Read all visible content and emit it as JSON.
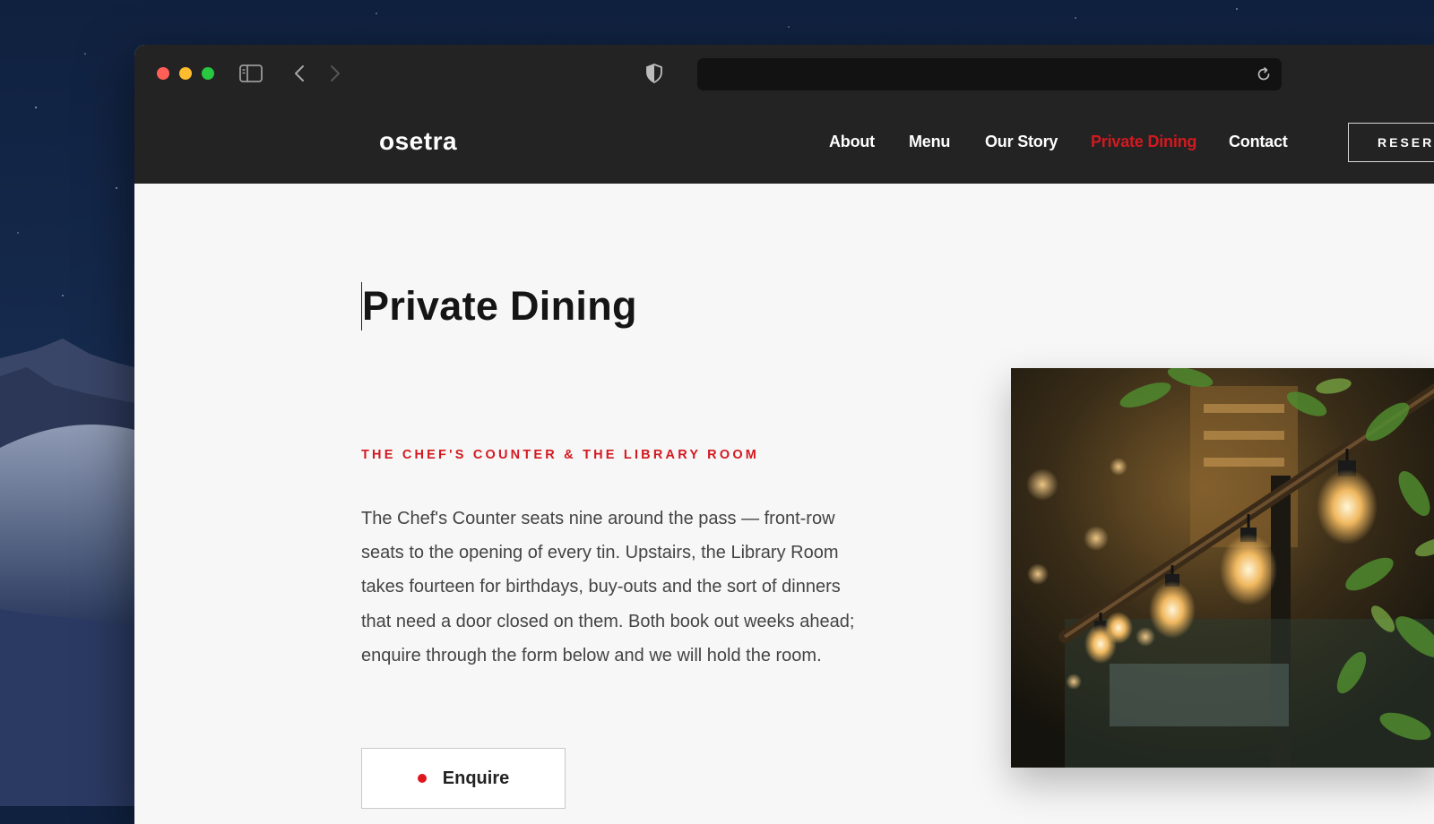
{
  "browser": {
    "url": "",
    "controls": {
      "close_color": "#ff5f57",
      "minimize_color": "#febc2e",
      "zoom_color": "#28c840"
    },
    "icons": [
      "sidebar-icon",
      "back-arrow-icon",
      "forward-arrow-icon",
      "shield-icon",
      "reload-icon"
    ]
  },
  "site": {
    "logo": "osetra",
    "nav": [
      {
        "label": "About",
        "active": false
      },
      {
        "label": "Menu",
        "active": false
      },
      {
        "label": "Our Story",
        "active": false
      },
      {
        "label": "Private Dining",
        "active": true
      },
      {
        "label": "Contact",
        "active": false
      }
    ],
    "reserve_label": "RESERV",
    "accent_color": "#d31920"
  },
  "page": {
    "title": "Private Dining",
    "eyebrow": "THE CHEF'S COUNTER & THE LIBRARY ROOM",
    "body": "The Chef's Counter seats nine around the pass — front-row seats to the opening of every tin. Upstairs, the Library Room takes fourteen for birthdays, buy-outs and the sort of dinners that need a door closed on them. Both book out weeks ahead; enquire through the form below and we will hold the room.",
    "enquire_label": "Enquire"
  }
}
